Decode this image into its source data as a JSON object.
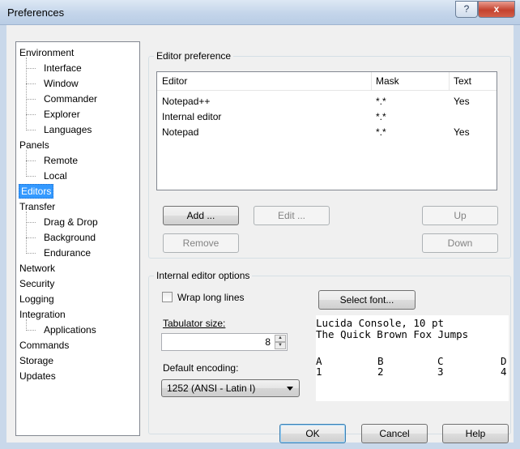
{
  "window": {
    "title": "Preferences",
    "help_glyph": "?",
    "close_glyph": "x"
  },
  "tree": {
    "items": [
      {
        "label": "Environment",
        "level": 0
      },
      {
        "label": "Interface",
        "level": 1
      },
      {
        "label": "Window",
        "level": 1
      },
      {
        "label": "Commander",
        "level": 1
      },
      {
        "label": "Explorer",
        "level": 1
      },
      {
        "label": "Languages",
        "level": 1
      },
      {
        "label": "Panels",
        "level": 0
      },
      {
        "label": "Remote",
        "level": 1
      },
      {
        "label": "Local",
        "level": 1
      },
      {
        "label": "Editors",
        "level": 0,
        "selected": true
      },
      {
        "label": "Transfer",
        "level": 0
      },
      {
        "label": "Drag & Drop",
        "level": 1
      },
      {
        "label": "Background",
        "level": 1
      },
      {
        "label": "Endurance",
        "level": 1
      },
      {
        "label": "Network",
        "level": 0
      },
      {
        "label": "Security",
        "level": 0
      },
      {
        "label": "Logging",
        "level": 0
      },
      {
        "label": "Integration",
        "level": 0
      },
      {
        "label": "Applications",
        "level": 1
      },
      {
        "label": "Commands",
        "level": 0
      },
      {
        "label": "Storage",
        "level": 0
      },
      {
        "label": "Updates",
        "level": 0
      }
    ]
  },
  "editor_pref": {
    "group_label": "Editor preference",
    "columns": [
      "Editor",
      "Mask",
      "Text"
    ],
    "rows": [
      [
        "Notepad++",
        "*.*",
        "Yes"
      ],
      [
        "Internal editor",
        "*.*",
        ""
      ],
      [
        "Notepad",
        "*.*",
        "Yes"
      ]
    ],
    "buttons": {
      "add": "Add ...",
      "edit": "Edit ...",
      "up": "Up",
      "remove": "Remove",
      "down": "Down"
    }
  },
  "internal": {
    "group_label": "Internal editor options",
    "wrap_label": "Wrap long lines",
    "wrap_checked": false,
    "tab_label": "Tabulator size:",
    "tab_value": "8",
    "encoding_label": "Default encoding:",
    "encoding_value": "1252  (ANSI - Latin I)",
    "select_font": "Select font...",
    "preview": {
      "line1": "Lucida Console, 10 pt",
      "line2": "The Quick Brown Fox Jumps",
      "cols": [
        "A",
        "B",
        "C",
        "D"
      ],
      "nums": [
        "1",
        "2",
        "3",
        "4"
      ]
    }
  },
  "footer": {
    "ok": "OK",
    "cancel": "Cancel",
    "help": "Help"
  },
  "colors": {
    "selection": "#3399ff",
    "title_gradient_top": "#dde8f4",
    "close_red": "#c4422e"
  }
}
